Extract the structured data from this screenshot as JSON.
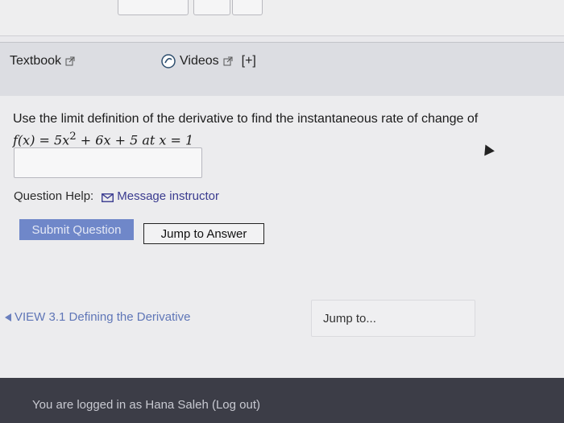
{
  "resource_bar": {
    "textbook_label": "Textbook",
    "videos_label": "Videos",
    "plus_label": "[+]"
  },
  "question": {
    "prompt": "Use the limit definition of the derivative to find the instantaneous rate of change of",
    "function_lhs": "f(x) = 5x",
    "exponent": "2",
    "function_rhs": " + 6x + 5 at x = 1",
    "answer_value": ""
  },
  "help": {
    "label": "Question Help:",
    "message_link": "Message instructor"
  },
  "buttons": {
    "submit_label": "Submit Question",
    "jump_answer_label": "Jump to Answer"
  },
  "nav": {
    "view_link": "VIEW 3.1 Defining the Derivative",
    "jump_to": "Jump to..."
  },
  "footer": {
    "login_text": "You are logged in as Hana Saleh (Log out)"
  },
  "icons": {
    "external": "external-link-icon",
    "video": "video-icon",
    "mail": "mail-icon",
    "back": "left-triangle-icon"
  },
  "colors": {
    "submit_bg": "#6f87c9",
    "link": "#3a3b8f",
    "footer_bg": "#3c3d47"
  }
}
